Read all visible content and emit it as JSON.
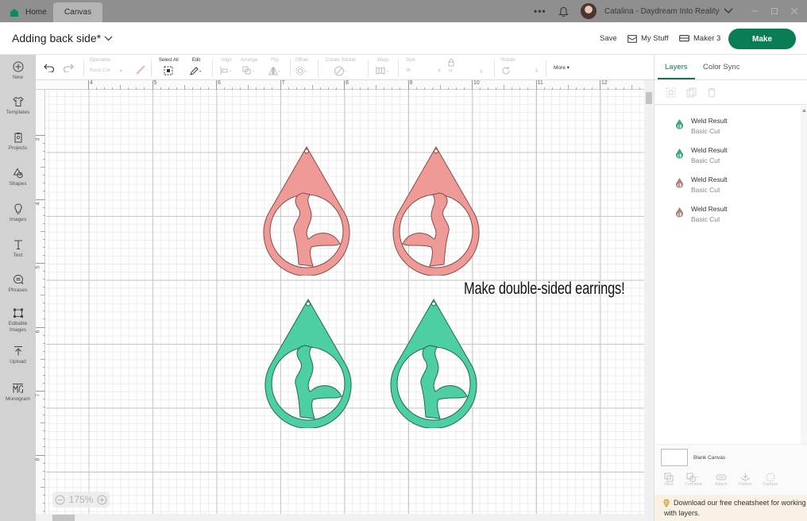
{
  "titlebar": {
    "tabs": [
      {
        "label": "Home",
        "icon": "home-icon"
      },
      {
        "label": "Canvas"
      }
    ],
    "more_label": "•••",
    "user_name": "Catalina - Daydream Into Reality"
  },
  "header": {
    "project_title": "Adding back side*",
    "save_label": "Save",
    "mystuff_label": "My Stuff",
    "machine_label": "Maker 3",
    "make_label": "Make"
  },
  "sidebar": {
    "items": [
      {
        "label": "New",
        "icon": "plus-circle-icon"
      },
      {
        "label": "Templates",
        "icon": "shirt-icon"
      },
      {
        "label": "Projects",
        "icon": "clipboard-icon"
      },
      {
        "label": "Shapes",
        "icon": "shapes-icon"
      },
      {
        "label": "Images",
        "icon": "lightbulb-icon"
      },
      {
        "label": "Text",
        "icon": "text-icon"
      },
      {
        "label": "Phrases",
        "icon": "speech-bubble-icon"
      },
      {
        "label": "Editable Images",
        "icon": "editable-image-icon"
      },
      {
        "label": "Upload",
        "icon": "upload-icon"
      },
      {
        "label": "Monogram",
        "icon": "monogram-icon"
      }
    ]
  },
  "toolbar": {
    "operation_label": "Operation",
    "operation_value": "Basic Cut",
    "select_all_label": "Select All",
    "edit_label": "Edit",
    "align_label": "Align",
    "arrange_label": "Arrange",
    "flip_label": "Flip",
    "offset_label": "Offset",
    "create_sticker_label": "Create Sticker",
    "warp_label": "Warp",
    "size_label": "Size",
    "width_prefix": "W",
    "height_prefix": "H",
    "rotate_label": "Rotate",
    "more_label": "More ▾"
  },
  "rulers": {
    "top": [
      "4",
      "5",
      "6",
      "7",
      "8",
      "9",
      "10",
      "11",
      "12"
    ],
    "left": [
      "3",
      "4",
      "5",
      "6",
      "7",
      "8"
    ]
  },
  "canvas": {
    "caption": "Make double-sided earrings!",
    "earrings": [
      {
        "color": "#ee9a97",
        "mirrored": false
      },
      {
        "color": "#ee9a97",
        "mirrored": true
      },
      {
        "color": "#4ecfa3",
        "mirrored": false
      },
      {
        "color": "#4ecfa3",
        "mirrored": false
      }
    ],
    "zoom_level": "175%"
  },
  "layers_panel": {
    "tabs": [
      {
        "label": "Layers"
      },
      {
        "label": "Color Sync"
      }
    ],
    "tools": [
      "group-icon",
      "duplicate-icon",
      "delete-icon"
    ],
    "layers": [
      {
        "name": "Weld Result",
        "type": "Basic Cut",
        "color": "#3fa57f"
      },
      {
        "name": "Weld Result",
        "type": "Basic Cut",
        "color": "#3fa57f"
      },
      {
        "name": "Weld Result",
        "type": "Basic Cut",
        "color": "#a9837a"
      },
      {
        "name": "Weld Result",
        "type": "Basic Cut",
        "color": "#a9837a"
      }
    ],
    "blank_canvas_label": "Blank Canvas",
    "actions": [
      {
        "label": "Slice"
      },
      {
        "label": "Combine"
      },
      {
        "label": "Attach"
      },
      {
        "label": "Flatten"
      },
      {
        "label": "Contour"
      }
    ],
    "tip": "Download our free cheatsheet for working with layers."
  },
  "colors": {
    "brand_green": "#0a7d57",
    "tab_accent": "#1e6e51",
    "pink": "#ee9a97",
    "teal": "#4ecfa3"
  }
}
